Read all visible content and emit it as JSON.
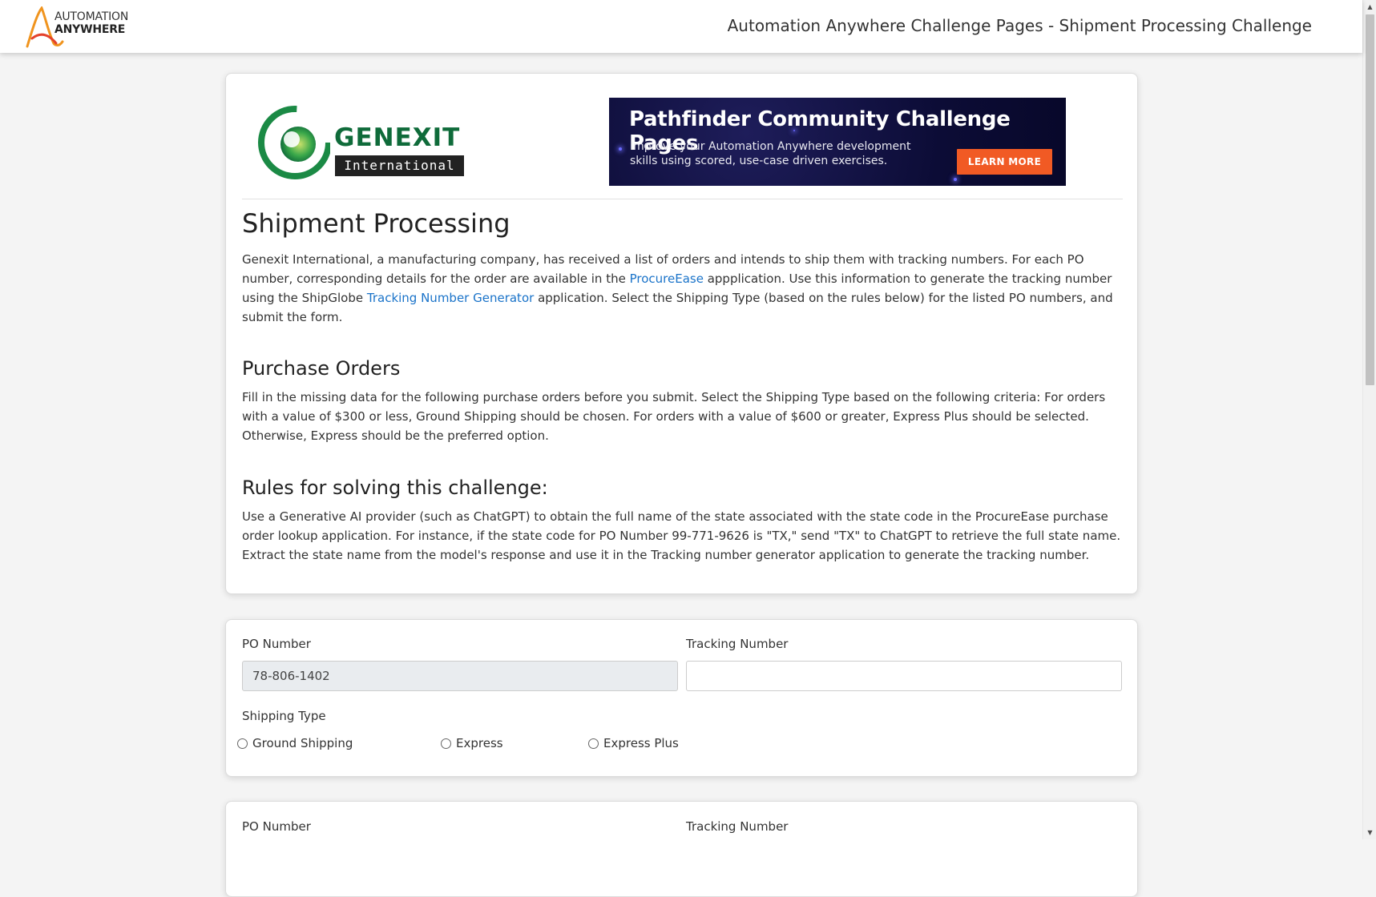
{
  "header": {
    "logo_line1": "AUTOMATION",
    "logo_line2": "ANYWHERE",
    "title": "Automation Anywhere Challenge Pages - Shipment Processing Challenge"
  },
  "company_logo": {
    "name": "GENEXIT",
    "subtitle": "International"
  },
  "banner": {
    "title": "Pathfinder Community Challenge Pages",
    "subtitle": "Improve your Automation Anywhere development skills using scored, use-case driven exercises.",
    "button_label": "LEARN MORE",
    "background": "#0c0c36",
    "button_color": "#f15a24"
  },
  "intro": {
    "heading": "Shipment Processing",
    "text_1": "Genexit International, a manufacturing company, has received a list of orders and intends to ship them with tracking numbers. For each PO number, corresponding details for the order are available in the ",
    "link_1": "ProcureEase",
    "text_2": " appplication. Use this information to generate the tracking number using the ShipGlobe ",
    "link_2": "Tracking Number Generator",
    "text_3": " application. Select the Shipping Type (based on the rules below) for the listed PO numbers, and submit the form."
  },
  "purchase_orders": {
    "heading": "Purchase Orders",
    "text": "Fill in the missing data for the following purchase orders before you submit. Select the Shipping Type based on the following criteria: For orders with a value of $300 or less, Ground Shipping should be chosen. For orders with a value of $600 or greater, Express Plus should be selected. Otherwise, Express should be the preferred option."
  },
  "rules": {
    "heading": "Rules for solving this challenge:",
    "text": "Use a Generative AI provider (such as ChatGPT) to obtain the full name of the state associated with the state code in the ProcureEase purchase order lookup application. For instance, if the state code for PO Number 99-771-9626 is \"TX,\" send \"TX\" to ChatGPT to retrieve the full state name. Extract the state name from the model's response and use it in the Tracking number generator application to generate the tracking number."
  },
  "form1": {
    "po_label": "PO Number",
    "po_value": "78-806-1402",
    "tracking_label": "Tracking Number",
    "tracking_value": "",
    "shipping_label": "Shipping Type",
    "options": [
      "Ground Shipping",
      "Express",
      "Express Plus"
    ]
  },
  "form2": {
    "po_label": "PO Number",
    "tracking_label": "Tracking Number"
  },
  "colors": {
    "link": "#1a73c9",
    "logo_green": "#0f6b3a"
  }
}
